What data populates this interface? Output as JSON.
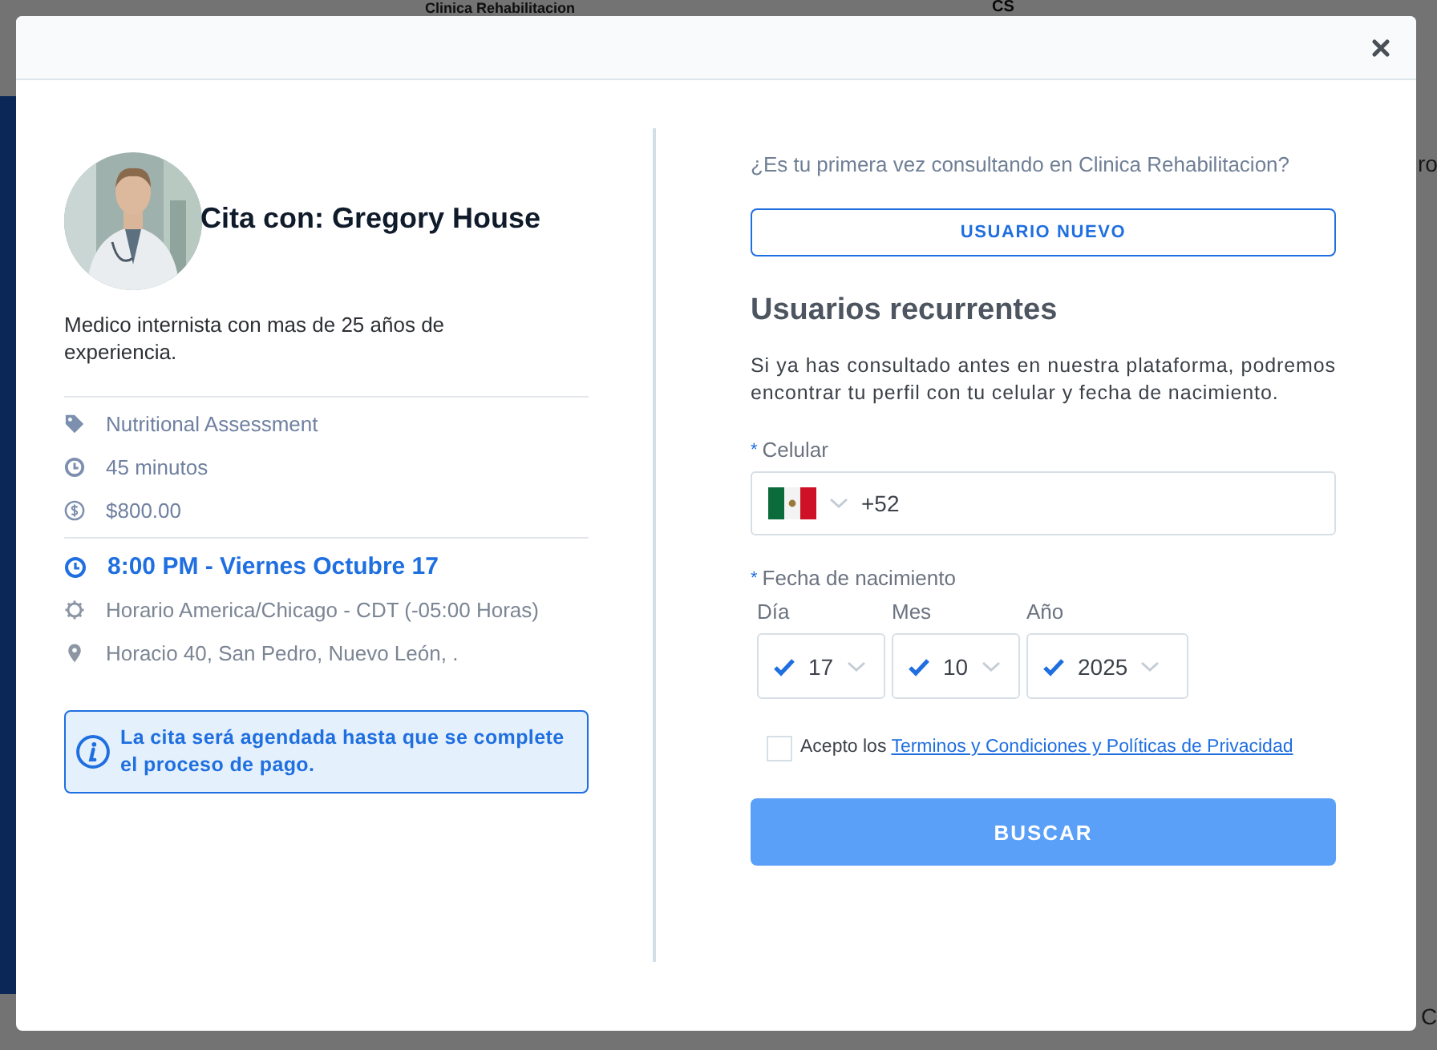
{
  "background": {
    "title": "Clinica Rehabilitacion",
    "logo_text": "CS",
    "edge_text_1": "ro",
    "edge_text_2": "C"
  },
  "doctor": {
    "title": "Cita con: Gregory House",
    "bio": "Medico internista con mas de 25 años de experiencia."
  },
  "details": [
    {
      "kind": "tag",
      "text": "Nutritional Assessment"
    },
    {
      "kind": "clock",
      "text": "45 minutos"
    },
    {
      "kind": "money",
      "text": "$800.00"
    },
    {
      "kind": "appointment",
      "text": "8:00 PM - Viernes Octubre 17"
    },
    {
      "kind": "timezone",
      "text": "Horario America/Chicago - CDT (-05:00 Horas)"
    },
    {
      "kind": "location",
      "text": "Horacio 40, San Pedro, Nuevo León, ."
    }
  ],
  "notice": "La cita será agendada hasta que se complete el proceso de pago.",
  "question": "¿Es tu primera vez consultando en Clinica Rehabilitacion?",
  "new_user_button": "USUARIO NUEVO",
  "section_title": "Usuarios recurrentes",
  "description": "Si ya has consultado antes en nuestra plataforma, podremos encontrar tu perfil con tu celular y fecha de nacimiento.",
  "phone": {
    "required_mark": "*",
    "label": "Celular",
    "country_code": "+52"
  },
  "birth_date": {
    "required_mark": "*",
    "label": "Fecha de nacimiento",
    "fields": [
      {
        "label": "Día",
        "value": "17",
        "valid": true
      },
      {
        "label": "Mes",
        "value": "10",
        "valid": true
      },
      {
        "label": "Año",
        "value": "2025",
        "valid": true
      }
    ]
  },
  "terms": {
    "checked": false,
    "prefix": "Acepto los",
    "link": "Terminos y Condiciones y Políticas de Privacidad"
  },
  "submit": {
    "label": "BUSCAR",
    "disabled": true
  }
}
